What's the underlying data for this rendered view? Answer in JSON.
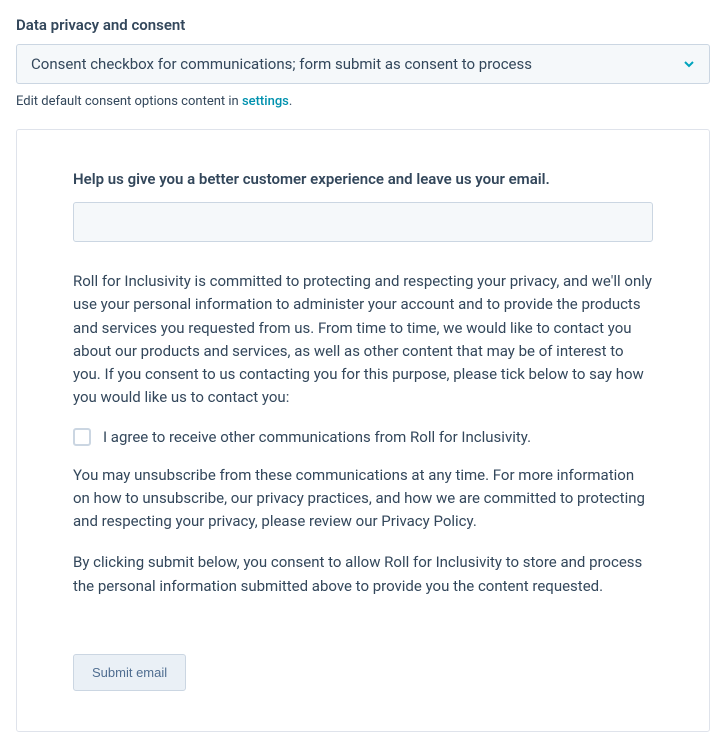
{
  "section": {
    "title": "Data privacy and consent"
  },
  "dropdown": {
    "selected": "Consent checkbox for communications; form submit as consent to process"
  },
  "hint": {
    "prefix": "Edit default consent options content in ",
    "link": "settings",
    "suffix": "."
  },
  "form": {
    "heading": "Help us give you a better customer experience and leave us your email.",
    "email_value": "",
    "privacy_intro": "Roll for Inclusivity is committed to protecting and respecting your privacy, and we'll only use your personal information to administer your account and to provide the products and services you requested from us. From time to time, we would like to contact you about our products and services, as well as other content that may be of interest to you. If you consent to us contacting you for this purpose, please tick below to say how you would like us to contact you:",
    "checkbox_label": "I agree to receive other communications from Roll for Inclusivity.",
    "unsubscribe_text": "You may unsubscribe from these communications at any time. For more information on how to unsubscribe, our privacy practices, and how we are committed to protecting and respecting your privacy, please review our Privacy Policy.",
    "consent_submit_text": "By clicking submit below, you consent to allow Roll for Inclusivity to store and process the personal information submitted above to provide you the content requested.",
    "submit_label": "Submit email"
  },
  "colors": {
    "link": "#0091ae",
    "border": "#cbd6e2",
    "text": "#33475b"
  }
}
